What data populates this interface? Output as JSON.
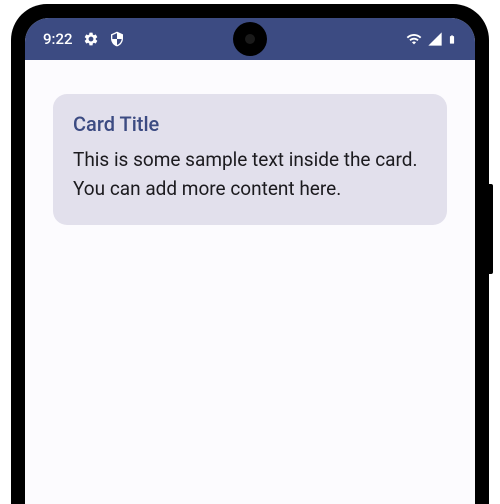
{
  "statusBar": {
    "time": "9:22"
  },
  "card": {
    "title": "Card Title",
    "body": "This is some sample text inside the card. You can add more content here."
  }
}
